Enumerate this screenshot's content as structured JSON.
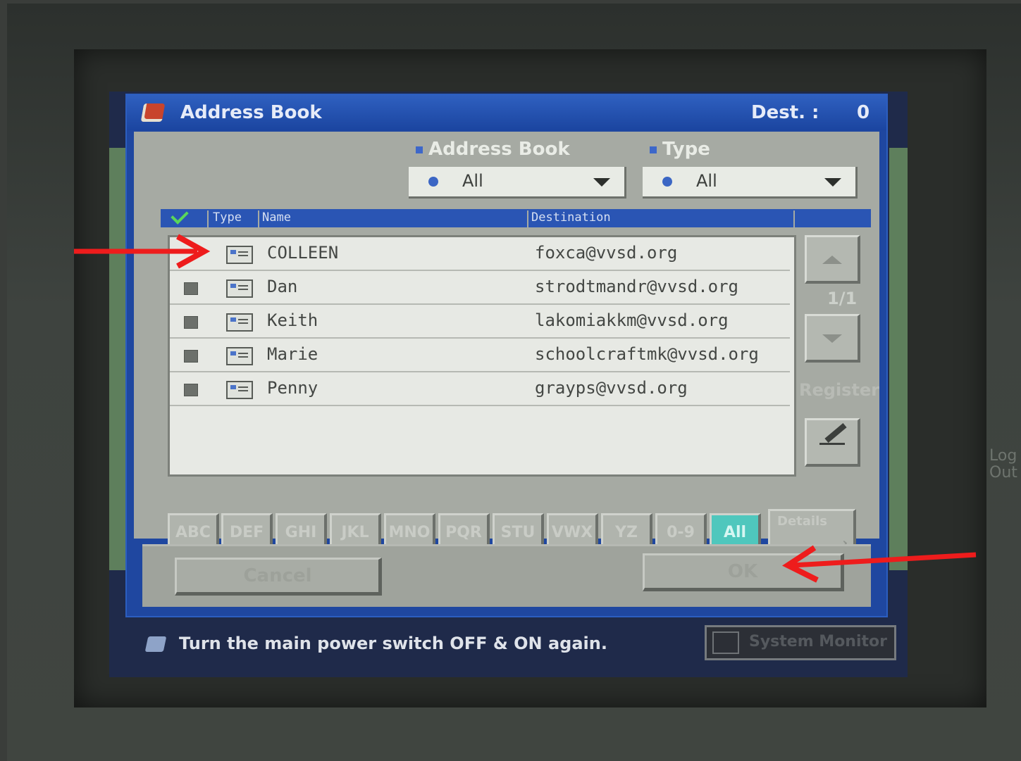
{
  "dialog": {
    "title": "Address Book",
    "dest_label": "Dest. :",
    "dest_count": "0"
  },
  "filters": {
    "address_book": {
      "label": "Address Book",
      "value": "All"
    },
    "type": {
      "label": "Type",
      "value": "All"
    }
  },
  "list": {
    "headers": {
      "type": "Type",
      "name": "Name",
      "destination": "Destination"
    },
    "rows": [
      {
        "name": "COLLEEN",
        "destination": "foxca@vvsd.org"
      },
      {
        "name": "Dan",
        "destination": "strodtmandr@vvsd.org"
      },
      {
        "name": "Keith",
        "destination": "lakomiakkm@vvsd.org"
      },
      {
        "name": "Marie",
        "destination": "schoolcraftmk@vvsd.org"
      },
      {
        "name": "Penny",
        "destination": "grayps@vvsd.org"
      }
    ]
  },
  "side": {
    "page_indicator": "1/1",
    "register_label": "Register"
  },
  "alpha_keys": [
    "ABC",
    "DEF",
    "GHI",
    "JKL",
    "MNO",
    "PQR",
    "STU",
    "VWX",
    "YZ",
    "0-9",
    "All"
  ],
  "details_label": "Details",
  "buttons": {
    "cancel": "Cancel",
    "ok": "OK"
  },
  "status": {
    "message": "Turn the main power switch OFF & ON again.",
    "system_monitor": "System Monitor"
  },
  "bezel": {
    "logout": "Log Out"
  },
  "colors": {
    "title_bar": "#1f47a0",
    "panel": "#a6aaa3",
    "active_key": "#4fc7bd",
    "annotation_arrow": "#ee1c1c"
  }
}
